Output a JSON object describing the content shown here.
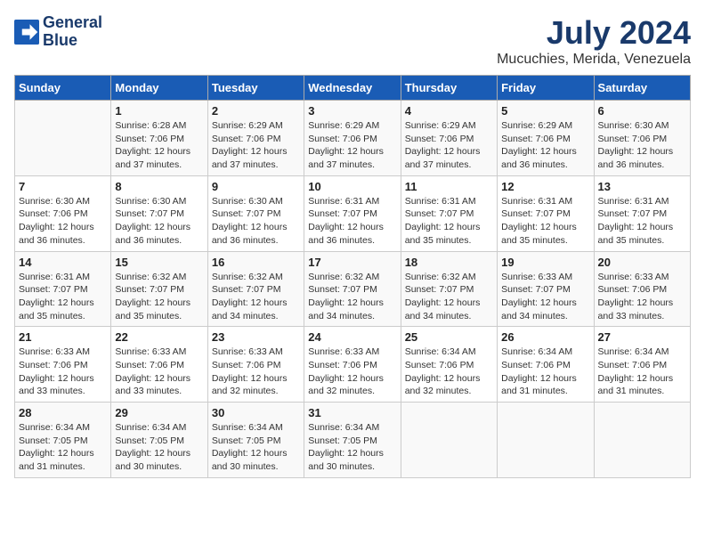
{
  "logo": {
    "line1": "General",
    "line2": "Blue"
  },
  "title": "July 2024",
  "location": "Mucuchies, Merida, Venezuela",
  "days_of_week": [
    "Sunday",
    "Monday",
    "Tuesday",
    "Wednesday",
    "Thursday",
    "Friday",
    "Saturday"
  ],
  "weeks": [
    [
      {
        "day": "",
        "info": ""
      },
      {
        "day": "1",
        "info": "Sunrise: 6:28 AM\nSunset: 7:06 PM\nDaylight: 12 hours\nand 37 minutes."
      },
      {
        "day": "2",
        "info": "Sunrise: 6:29 AM\nSunset: 7:06 PM\nDaylight: 12 hours\nand 37 minutes."
      },
      {
        "day": "3",
        "info": "Sunrise: 6:29 AM\nSunset: 7:06 PM\nDaylight: 12 hours\nand 37 minutes."
      },
      {
        "day": "4",
        "info": "Sunrise: 6:29 AM\nSunset: 7:06 PM\nDaylight: 12 hours\nand 37 minutes."
      },
      {
        "day": "5",
        "info": "Sunrise: 6:29 AM\nSunset: 7:06 PM\nDaylight: 12 hours\nand 36 minutes."
      },
      {
        "day": "6",
        "info": "Sunrise: 6:30 AM\nSunset: 7:06 PM\nDaylight: 12 hours\nand 36 minutes."
      }
    ],
    [
      {
        "day": "7",
        "info": "Sunrise: 6:30 AM\nSunset: 7:06 PM\nDaylight: 12 hours\nand 36 minutes."
      },
      {
        "day": "8",
        "info": "Sunrise: 6:30 AM\nSunset: 7:07 PM\nDaylight: 12 hours\nand 36 minutes."
      },
      {
        "day": "9",
        "info": "Sunrise: 6:30 AM\nSunset: 7:07 PM\nDaylight: 12 hours\nand 36 minutes."
      },
      {
        "day": "10",
        "info": "Sunrise: 6:31 AM\nSunset: 7:07 PM\nDaylight: 12 hours\nand 36 minutes."
      },
      {
        "day": "11",
        "info": "Sunrise: 6:31 AM\nSunset: 7:07 PM\nDaylight: 12 hours\nand 35 minutes."
      },
      {
        "day": "12",
        "info": "Sunrise: 6:31 AM\nSunset: 7:07 PM\nDaylight: 12 hours\nand 35 minutes."
      },
      {
        "day": "13",
        "info": "Sunrise: 6:31 AM\nSunset: 7:07 PM\nDaylight: 12 hours\nand 35 minutes."
      }
    ],
    [
      {
        "day": "14",
        "info": "Sunrise: 6:31 AM\nSunset: 7:07 PM\nDaylight: 12 hours\nand 35 minutes."
      },
      {
        "day": "15",
        "info": "Sunrise: 6:32 AM\nSunset: 7:07 PM\nDaylight: 12 hours\nand 35 minutes."
      },
      {
        "day": "16",
        "info": "Sunrise: 6:32 AM\nSunset: 7:07 PM\nDaylight: 12 hours\nand 34 minutes."
      },
      {
        "day": "17",
        "info": "Sunrise: 6:32 AM\nSunset: 7:07 PM\nDaylight: 12 hours\nand 34 minutes."
      },
      {
        "day": "18",
        "info": "Sunrise: 6:32 AM\nSunset: 7:07 PM\nDaylight: 12 hours\nand 34 minutes."
      },
      {
        "day": "19",
        "info": "Sunrise: 6:33 AM\nSunset: 7:07 PM\nDaylight: 12 hours\nand 34 minutes."
      },
      {
        "day": "20",
        "info": "Sunrise: 6:33 AM\nSunset: 7:06 PM\nDaylight: 12 hours\nand 33 minutes."
      }
    ],
    [
      {
        "day": "21",
        "info": "Sunrise: 6:33 AM\nSunset: 7:06 PM\nDaylight: 12 hours\nand 33 minutes."
      },
      {
        "day": "22",
        "info": "Sunrise: 6:33 AM\nSunset: 7:06 PM\nDaylight: 12 hours\nand 33 minutes."
      },
      {
        "day": "23",
        "info": "Sunrise: 6:33 AM\nSunset: 7:06 PM\nDaylight: 12 hours\nand 32 minutes."
      },
      {
        "day": "24",
        "info": "Sunrise: 6:33 AM\nSunset: 7:06 PM\nDaylight: 12 hours\nand 32 minutes."
      },
      {
        "day": "25",
        "info": "Sunrise: 6:34 AM\nSunset: 7:06 PM\nDaylight: 12 hours\nand 32 minutes."
      },
      {
        "day": "26",
        "info": "Sunrise: 6:34 AM\nSunset: 7:06 PM\nDaylight: 12 hours\nand 31 minutes."
      },
      {
        "day": "27",
        "info": "Sunrise: 6:34 AM\nSunset: 7:06 PM\nDaylight: 12 hours\nand 31 minutes."
      }
    ],
    [
      {
        "day": "28",
        "info": "Sunrise: 6:34 AM\nSunset: 7:05 PM\nDaylight: 12 hours\nand 31 minutes."
      },
      {
        "day": "29",
        "info": "Sunrise: 6:34 AM\nSunset: 7:05 PM\nDaylight: 12 hours\nand 30 minutes."
      },
      {
        "day": "30",
        "info": "Sunrise: 6:34 AM\nSunset: 7:05 PM\nDaylight: 12 hours\nand 30 minutes."
      },
      {
        "day": "31",
        "info": "Sunrise: 6:34 AM\nSunset: 7:05 PM\nDaylight: 12 hours\nand 30 minutes."
      },
      {
        "day": "",
        "info": ""
      },
      {
        "day": "",
        "info": ""
      },
      {
        "day": "",
        "info": ""
      }
    ]
  ]
}
